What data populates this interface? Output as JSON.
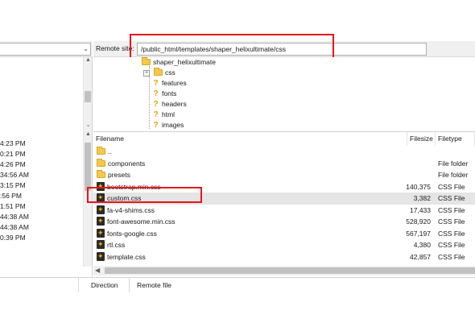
{
  "remote": {
    "site_label": "Remote site:",
    "path": "/public_html/templates/shaper_helixultimate/css",
    "tree": [
      {
        "label": "shaper_helixultimate",
        "icon": "folder-icon"
      },
      {
        "label": "css",
        "icon": "folder-icon",
        "expander": "+"
      },
      {
        "label": "features",
        "icon": "question-icon"
      },
      {
        "label": "fonts",
        "icon": "question-icon"
      },
      {
        "label": "headers",
        "icon": "question-icon"
      },
      {
        "label": "html",
        "icon": "question-icon"
      },
      {
        "label": "images",
        "icon": "question-icon"
      }
    ],
    "columns": {
      "name": "Filename",
      "size": "Filesize",
      "type": "Filetype"
    },
    "files": [
      {
        "name": "..",
        "size": "",
        "type": "",
        "icon": "folder-icon"
      },
      {
        "name": "components",
        "size": "",
        "type": "File folder",
        "icon": "folder-icon"
      },
      {
        "name": "presets",
        "size": "",
        "type": "File folder",
        "icon": "folder-icon"
      },
      {
        "name": "bootstrap.min.css",
        "size": "140,375",
        "type": "CSS File",
        "icon": "css-file-icon"
      },
      {
        "name": "custom.css",
        "size": "3,382",
        "type": "CSS File",
        "icon": "css-file-icon"
      },
      {
        "name": "fa-v4-shims.css",
        "size": "17,433",
        "type": "CSS File",
        "icon": "css-file-icon"
      },
      {
        "name": "font-awesome.min.css",
        "size": "528,920",
        "type": "CSS File",
        "icon": "css-file-icon"
      },
      {
        "name": "fonts-google.css",
        "size": "567,197",
        "type": "CSS File",
        "icon": "css-file-icon"
      },
      {
        "name": "rtl.css",
        "size": "4,380",
        "type": "CSS File",
        "icon": "css-file-icon"
      },
      {
        "name": "template.css",
        "size": "42,857",
        "type": "CSS File",
        "icon": "css-file-icon"
      }
    ]
  },
  "local": {
    "times": [
      "4:23 PM",
      "0:21 PM",
      "4:26 PM",
      "34:56 AM",
      "3:15 PM",
      ":56 PM",
      "1:51 PM",
      "44:38 AM",
      "44:38 AM",
      "0:39 PM"
    ]
  },
  "queue": {
    "direction": "Direction",
    "remote_file": "Remote file"
  },
  "colors": {
    "highlight": "#e8141b",
    "selected_row": "#e5e5e5"
  }
}
